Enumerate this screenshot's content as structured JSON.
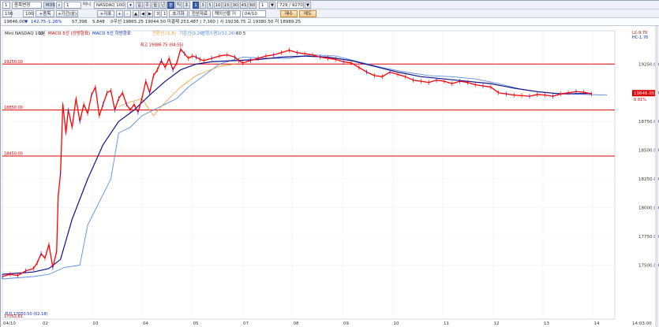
{
  "toolbar1": {
    "row_label": "1",
    "market_dropdown": "종목변경",
    "code_input": "M3S",
    "period_num": "1",
    "period_unit": "101",
    "add_button": "+종목",
    "ratio_button": "=7선",
    "symbol_prefix": "미니",
    "symbol_name": "NASDAQ 100",
    "interval_buttons": [
      "일",
      "주",
      "월",
      "년",
      "분",
      "틱",
      "초"
    ],
    "minute_values": [
      "1",
      "3",
      "5",
      "10",
      "15",
      "30",
      "45",
      "60"
    ],
    "count_value": "1",
    "count_unit": "▼",
    "range_value": "729 / 9270",
    "range_suffix": "▼",
    "active_interval": "분"
  },
  "toolbar2": {
    "input1": "100",
    "input2": "100",
    "btn_indicator": "+종목",
    "btn_compare": "+기간(분)",
    "btn_index": "+지표",
    "btn_zoom_in": "+",
    "btn_zoom_out": "-",
    "nav_buttons": [
      "▲",
      "◀",
      "▶",
      "3",
      "1"
    ],
    "btn_default": "초기화",
    "btn_save": "전산자료",
    "btn_period_select": "해외선물 이",
    "date_input": "04/10",
    "btn_buy": "매수",
    "btn_sell": "매도"
  },
  "info_line": {
    "current": "19846.00",
    "change_arrow": "▼",
    "change": "142.75",
    "change_pct": "-1.26%",
    "volume": "57,398",
    "vol2": "5,848",
    "info_text": "③우선 19865.25 19044.50 미결제 253,487 ( 7,160 ) 시 19236.75 고 19380.50 저 18989.25"
  },
  "legend": {
    "title": "Mini NASDAQ 100",
    "period": "1분",
    "macd1": "MACD 5선 (상방향표)",
    "macd2": "MACD 5선 하방향표",
    "ichimoku": "전환선 (1,8)",
    "base": "기준선(9,26)",
    "span_text": "선행스팬2(52,26)",
    "nums": "60  5"
  },
  "annotations": {
    "high": "최고 19386.75 (04:55)",
    "low": "최저 17050.50 (02:18)",
    "bottom_left_price": "17052.61"
  },
  "right_box": {
    "current_price": "19846.00",
    "line2": "0.91%",
    "top_label1": "LC-9.70",
    "top_label2": "HC-1.76"
  },
  "colors": {
    "price_up": "#ff0000",
    "price_down": "#1a1aff",
    "ma_navy": "#10108a",
    "ichimoku_blue": "#5a8de0",
    "orange": "#f29a2e",
    "grid": "#d8dde6",
    "hline": "#e00000"
  },
  "chart_data": {
    "type": "line",
    "title": "Mini NASDAQ 100",
    "y_ticks": [
      19250,
      18750,
      18250,
      17750,
      17500
    ],
    "y_labels": [
      "19250.00",
      "18750.00",
      "18250.00",
      "17750.00",
      "17500.00"
    ],
    "y_ticks_extra": [
      19000,
      18500,
      18000
    ],
    "y_labels_extra": [
      "19000.00",
      "18500.00",
      "18000.00"
    ],
    "ylim": [
      17030,
      19540
    ],
    "x_labels": [
      "04/10",
      "02",
      "03",
      "04",
      "05",
      "07",
      "08",
      "09",
      "10",
      "11",
      "12",
      "13",
      "14"
    ],
    "x_last_label": "14:03:00",
    "horizontal_levels": [
      19250,
      18850,
      18450
    ],
    "horizontal_level_labels": [
      "19250.00",
      "18850.00",
      "18450.00"
    ],
    "price_series": [
      [
        0,
        17400
      ],
      [
        10,
        17420
      ],
      [
        20,
        17410
      ],
      [
        30,
        17450
      ],
      [
        40,
        17470
      ],
      [
        45,
        17520
      ],
      [
        50,
        17600
      ],
      [
        55,
        17560
      ],
      [
        60,
        17680
      ],
      [
        65,
        17480
      ],
      [
        70,
        17620
      ],
      [
        72,
        18100
      ],
      [
        75,
        18300
      ],
      [
        78,
        18900
      ],
      [
        82,
        18650
      ],
      [
        85,
        18850
      ],
      [
        90,
        18700
      ],
      [
        95,
        18950
      ],
      [
        100,
        18750
      ],
      [
        105,
        18900
      ],
      [
        110,
        18820
      ],
      [
        115,
        18980
      ],
      [
        120,
        19050
      ],
      [
        125,
        18800
      ],
      [
        130,
        18900
      ],
      [
        135,
        19000
      ],
      [
        140,
        19020
      ],
      [
        145,
        18850
      ],
      [
        150,
        18950
      ],
      [
        155,
        19000
      ],
      [
        160,
        18900
      ],
      [
        165,
        18850
      ],
      [
        170,
        18900
      ],
      [
        175,
        18830
      ],
      [
        180,
        18950
      ],
      [
        185,
        19100
      ],
      [
        190,
        19000
      ],
      [
        195,
        19150
      ],
      [
        200,
        19200
      ],
      [
        205,
        19280
      ],
      [
        210,
        19220
      ],
      [
        215,
        19300
      ],
      [
        220,
        19200
      ],
      [
        225,
        19260
      ],
      [
        230,
        19380
      ],
      [
        235,
        19340
      ],
      [
        240,
        19300
      ],
      [
        245,
        19320
      ],
      [
        250,
        19310
      ],
      [
        255,
        19290
      ],
      [
        260,
        19280
      ],
      [
        270,
        19300
      ],
      [
        280,
        19320
      ],
      [
        290,
        19330
      ],
      [
        300,
        19310
      ],
      [
        305,
        19280
      ],
      [
        310,
        19260
      ],
      [
        320,
        19280
      ],
      [
        330,
        19300
      ],
      [
        340,
        19320
      ],
      [
        350,
        19330
      ],
      [
        360,
        19350
      ],
      [
        370,
        19370
      ],
      [
        380,
        19350
      ],
      [
        390,
        19340
      ],
      [
        400,
        19330
      ],
      [
        410,
        19310
      ],
      [
        420,
        19300
      ],
      [
        430,
        19290
      ],
      [
        440,
        19270
      ],
      [
        450,
        19260
      ],
      [
        460,
        19220
      ],
      [
        470,
        19180
      ],
      [
        480,
        19150
      ],
      [
        490,
        19140
      ],
      [
        500,
        19180
      ],
      [
        510,
        19160
      ],
      [
        520,
        19140
      ],
      [
        530,
        19110
      ],
      [
        540,
        19100
      ],
      [
        550,
        19090
      ],
      [
        560,
        19110
      ],
      [
        570,
        19100
      ],
      [
        580,
        19080
      ],
      [
        590,
        19100
      ],
      [
        600,
        19090
      ],
      [
        610,
        19070
      ],
      [
        620,
        19060
      ],
      [
        630,
        19050
      ],
      [
        640,
        19000
      ],
      [
        650,
        18990
      ],
      [
        660,
        18980
      ],
      [
        670,
        18975
      ],
      [
        680,
        18970
      ],
      [
        690,
        18985
      ],
      [
        700,
        18980
      ],
      [
        710,
        18970
      ],
      [
        720,
        18990
      ],
      [
        730,
        19000
      ],
      [
        740,
        19010
      ],
      [
        750,
        19005
      ],
      [
        760,
        18990
      ]
    ],
    "ma_series": [
      [
        0,
        17420
      ],
      [
        40,
        17440
      ],
      [
        60,
        17470
      ],
      [
        75,
        17550
      ],
      [
        90,
        17900
      ],
      [
        110,
        18250
      ],
      [
        130,
        18550
      ],
      [
        150,
        18750
      ],
      [
        170,
        18850
      ],
      [
        190,
        18980
      ],
      [
        210,
        19100
      ],
      [
        230,
        19200
      ],
      [
        250,
        19250
      ],
      [
        270,
        19270
      ],
      [
        300,
        19280
      ],
      [
        330,
        19290
      ],
      [
        360,
        19310
      ],
      [
        390,
        19320
      ],
      [
        420,
        19310
      ],
      [
        450,
        19280
      ],
      [
        480,
        19230
      ],
      [
        510,
        19180
      ],
      [
        540,
        19140
      ],
      [
        570,
        19120
      ],
      [
        600,
        19100
      ],
      [
        630,
        19080
      ],
      [
        660,
        19040
      ],
      [
        690,
        19010
      ],
      [
        720,
        18990
      ],
      [
        760,
        18995
      ]
    ],
    "ichimoku_series": [
      [
        0,
        17380
      ],
      [
        40,
        17400
      ],
      [
        60,
        17420
      ],
      [
        80,
        17480
      ],
      [
        100,
        17500
      ],
      [
        110,
        17850
      ],
      [
        125,
        18050
      ],
      [
        140,
        18250
      ],
      [
        150,
        18650
      ],
      [
        165,
        18700
      ],
      [
        180,
        18800
      ],
      [
        195,
        18850
      ],
      [
        210,
        18900
      ],
      [
        225,
        18950
      ],
      [
        240,
        19050
      ],
      [
        260,
        19150
      ],
      [
        280,
        19250
      ],
      [
        310,
        19310
      ],
      [
        340,
        19300
      ],
      [
        370,
        19300
      ],
      [
        400,
        19330
      ],
      [
        430,
        19320
      ],
      [
        460,
        19270
      ],
      [
        490,
        19220
      ],
      [
        520,
        19180
      ],
      [
        550,
        19150
      ],
      [
        580,
        19140
      ],
      [
        610,
        19120
      ],
      [
        640,
        19080
      ],
      [
        670,
        19030
      ],
      [
        700,
        19000
      ],
      [
        730,
        18990
      ],
      [
        780,
        18980
      ]
    ],
    "orange_series": [
      [
        150,
        18880
      ],
      [
        165,
        18920
      ],
      [
        180,
        18950
      ],
      [
        195,
        18800
      ],
      [
        205,
        18880
      ],
      [
        215,
        18950
      ],
      [
        230,
        19050
      ],
      [
        250,
        19150
      ],
      [
        280,
        19230
      ],
      [
        300,
        19250
      ],
      [
        760,
        19020
      ],
      [
        790,
        19020
      ]
    ]
  }
}
